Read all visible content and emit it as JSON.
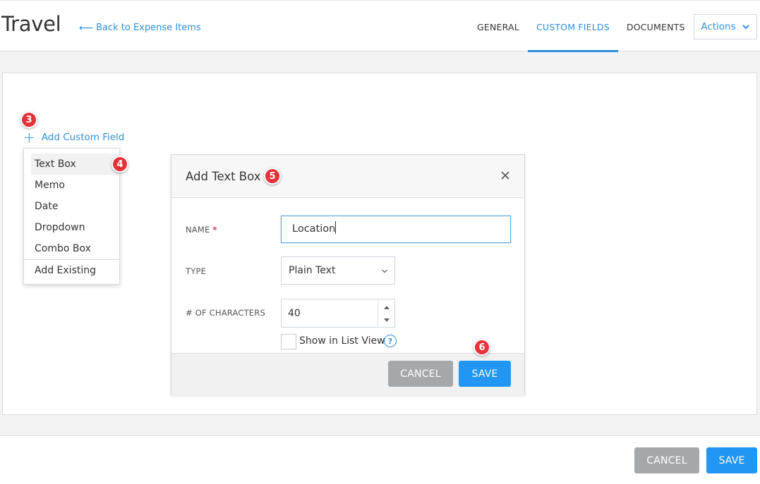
{
  "header": {
    "title": "Travel",
    "back_link": "Back to Expense Items",
    "tabs": [
      {
        "label": "GENERAL"
      },
      {
        "label": "CUSTOM FIELDS"
      },
      {
        "label": "DOCUMENTS"
      }
    ],
    "actions_label": "Actions"
  },
  "steps": {
    "step3": "3",
    "step4": "4",
    "step5": "5",
    "step6": "6"
  },
  "custom_fields": {
    "add_label": "Add Custom Field",
    "menu_items": [
      {
        "label": "Text Box"
      },
      {
        "label": "Memo"
      },
      {
        "label": "Date"
      },
      {
        "label": "Dropdown"
      },
      {
        "label": "Combo Box"
      },
      {
        "label": "Add Existing"
      }
    ]
  },
  "modal": {
    "title": "Add Text Box",
    "name_label": "NAME",
    "required_mark": "*",
    "name_value": "Location",
    "type_label": "TYPE",
    "type_value": "Plain Text",
    "chars_label": "# OF CHARACTERS",
    "chars_value": "40",
    "show_list_label": "Show in List View",
    "help_glyph": "?",
    "cancel_label": "CANCEL",
    "save_label": "SAVE"
  },
  "footer": {
    "cancel_label": "CANCEL",
    "save_label": "SAVE"
  },
  "colors": {
    "accent": "#2f8fdb",
    "button_blue": "#2196f3",
    "button_gray": "#a5a8ab",
    "badge_red": "#e5333a"
  }
}
